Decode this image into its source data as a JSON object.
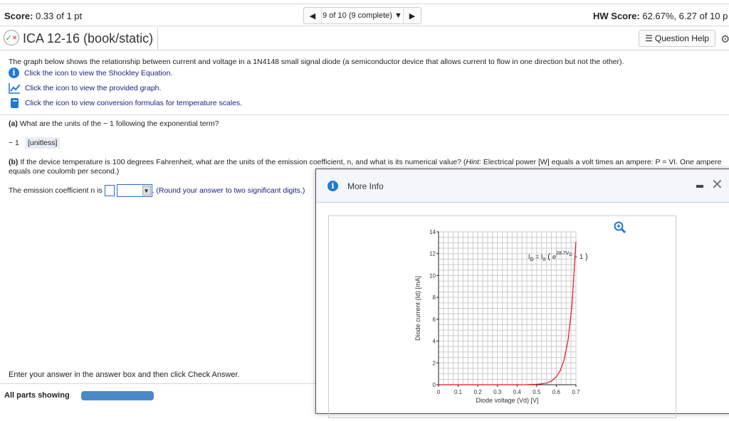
{
  "header": {
    "score_label": "Score:",
    "score_value": "0.33 of 1 pt",
    "nav_text": "9 of 10 (9 complete)",
    "hw_label": "HW Score:",
    "hw_value": "62.67%, 6.27 of 10 p"
  },
  "title": {
    "text": "ICA 12-16 (book/static)",
    "question_help": "Question Help"
  },
  "body": {
    "intro": "The graph below shows the relationship between current and voltage in a 1N4148 small signal diode (a semiconductor device that allows current to flow in one direction but not the other).",
    "links": [
      "Click the icon to view the Shockley Equation.",
      "Click the icon to view the provided graph.",
      "Click the icon to view conversion formulas for temperature scales."
    ],
    "part_a_label": "(a)",
    "part_a": "What are the units of the − 1 following the exponential term?",
    "part_a_prefix": "− 1",
    "part_a_answer": "[unitless]",
    "part_b_label": "(b)",
    "part_b_1": "If the device temperature is 100 degrees Fahrenheit, what are the units of the emission coefficient, n, and what is its numerical value? (",
    "hint_label": "Hint:",
    "part_b_2": " Electrical power [W] equals a volt times an ampere: P = VI. One ampere",
    "part_b_3": "equals one coulomb per second.)",
    "emission_label": "The emission coefficient n is",
    "round_note": ". (Round your answer to two significant digits.)",
    "instruction": "Enter your answer in the answer box and then click Check Answer.",
    "all_parts": "All parts showing"
  },
  "dialog": {
    "title": "More Info"
  },
  "chart_data": {
    "type": "line",
    "xlabel": "Diode voltage (Vd) [V]",
    "ylabel": "Diode current (Id) [mA]",
    "xlim": [
      0,
      0.7
    ],
    "ylim": [
      0,
      14
    ],
    "grid": true,
    "xticks": [
      "0",
      "0.1",
      "0.2",
      "0.3",
      "0.4",
      "0.5",
      "0.6",
      "0.7"
    ],
    "yticks": [
      "0",
      "2",
      "4",
      "6",
      "8",
      "10",
      "12",
      "14"
    ],
    "equation": {
      "lhs": "I",
      "lhs_sub": "D",
      "eq": "= I",
      "i0_sub": "0",
      "e": "e",
      "exp": "28.7V",
      "exp_sub": "D",
      "tail": "− 1"
    },
    "series": [
      {
        "color": "#e8101a",
        "x": [
          0,
          0.1,
          0.2,
          0.3,
          0.4,
          0.45,
          0.5,
          0.525,
          0.55,
          0.575,
          0.6,
          0.62,
          0.64,
          0.66,
          0.68,
          0.7
        ],
        "y": [
          0,
          0,
          0,
          0,
          0.002,
          0.01,
          0.04,
          0.08,
          0.16,
          0.33,
          0.73,
          1.3,
          2.3,
          4.1,
          7.3,
          13.1
        ]
      }
    ]
  }
}
